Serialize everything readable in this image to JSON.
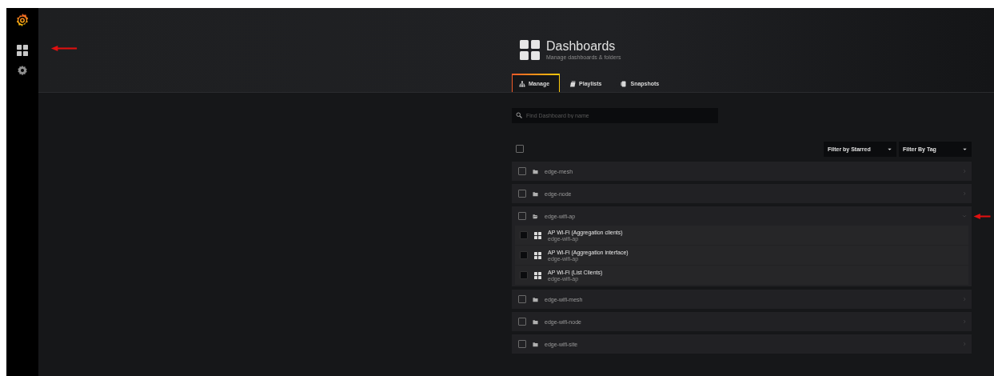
{
  "sidebar": {
    "items": [
      {
        "kind": "dashboards",
        "selected": true
      },
      {
        "kind": "settings",
        "selected": false
      }
    ]
  },
  "header": {
    "title": "Dashboards",
    "subtitle": "Manage dashboards & folders"
  },
  "tabs": [
    {
      "label": "Manage",
      "kind": "manage",
      "selected": true
    },
    {
      "label": "Playlists",
      "kind": "playlists",
      "selected": false
    },
    {
      "label": "Snapshots",
      "kind": "snapshots",
      "selected": false
    }
  ],
  "search": {
    "placeholder": "Find Dashboard by name"
  },
  "select_all": {
    "checked": false
  },
  "filters": [
    "Filter by Starred",
    "Filter By Tag"
  ],
  "folders": [
    {
      "name": "edge-mesh",
      "expanded": false,
      "checked": false
    },
    {
      "name": "edge-node",
      "expanded": false,
      "checked": false
    },
    {
      "name": "edge-wifi-ap",
      "expanded": true,
      "checked": false,
      "dashboards": [
        {
          "title": "AP Wi-Fi (Aggregation clients)",
          "folder": "edge-wifi-ap",
          "checked": false
        },
        {
          "title": "AP Wi-Fi (Aggregation interface)",
          "folder": "edge-wifi-ap",
          "checked": false
        },
        {
          "title": "AP Wi-Fi (List Clients)",
          "folder": "edge-wifi-ap",
          "checked": false
        }
      ]
    },
    {
      "name": "edge-wifi-mesh",
      "expanded": false,
      "checked": false
    },
    {
      "name": "edge-wifi-node",
      "expanded": false,
      "checked": false
    },
    {
      "name": "edge-wifi-site",
      "expanded": false,
      "checked": false
    }
  ]
}
